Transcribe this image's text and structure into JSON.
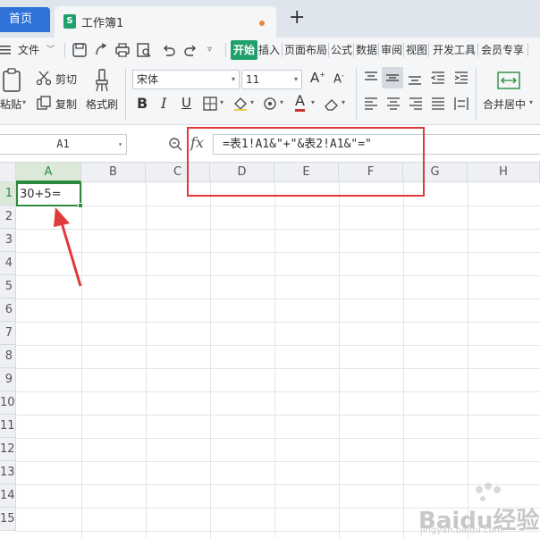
{
  "tabs": {
    "home": "首页",
    "doc_title": "工作簿1",
    "doc_icon": "S",
    "add": "+"
  },
  "menu": {
    "file": "文件",
    "items": [
      "开始",
      "插入",
      "页面布局",
      "公式",
      "数据",
      "审阅",
      "视图",
      "开发工具",
      "会员专享"
    ],
    "active_index": 0
  },
  "ribbon": {
    "paste": "粘贴",
    "cut": "剪切",
    "copy": "复制",
    "format_painter": "格式刷",
    "font_name": "宋体",
    "font_size": "11",
    "merge_center": "合并居中"
  },
  "formula_bar": {
    "name_box": "A1",
    "fx": "fx",
    "formula": "=表1!A1&\"+\"&表2!A1&\"=\""
  },
  "sheet": {
    "columns": [
      "A",
      "B",
      "C",
      "D",
      "E",
      "F",
      "G",
      "H"
    ],
    "rows": [
      "1",
      "2",
      "3",
      "4",
      "5",
      "6",
      "7",
      "8",
      "9",
      "10",
      "11",
      "12",
      "13",
      "14",
      "15"
    ],
    "selected_col": "A",
    "selected_row": "1",
    "a1_value": "30+5="
  },
  "watermark": {
    "brand": "Baidu经验",
    "url": "jingyan.baidu.com"
  },
  "colors": {
    "accent_green": "#2a8a3e",
    "tab_blue": "#2f73d8",
    "annotation_red": "#e03a3a"
  }
}
